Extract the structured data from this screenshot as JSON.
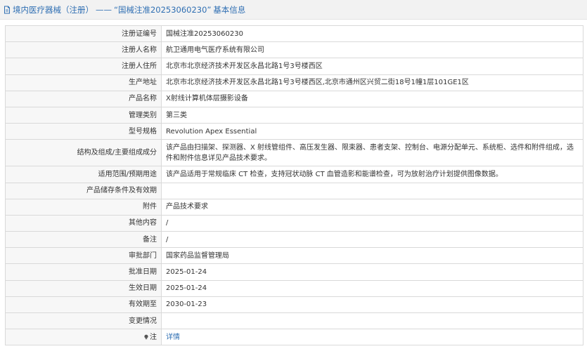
{
  "header": {
    "icon": "document-icon",
    "category": "境内医疗器械（注册）",
    "separator": "——",
    "reg_quote": "“国械注准20253060230”",
    "section": "基本信息"
  },
  "rows": [
    {
      "label": "注册证编号",
      "value": "国械注准20253060230"
    },
    {
      "label": "注册人名称",
      "value": "航卫通用电气医疗系统有限公司"
    },
    {
      "label": "注册人住所",
      "value": "北京市北京经济技术开发区永昌北路1号3号楼西区"
    },
    {
      "label": "生产地址",
      "value": "北京市北京经济技术开发区永昌北路1号3号楼西区,北京市通州区兴贸二街18号1幢1层101GE1区"
    },
    {
      "label": "产品名称",
      "value": "X射线计算机体层摄影设备"
    },
    {
      "label": "管理类别",
      "value": "第三类"
    },
    {
      "label": "型号规格",
      "value": "Revolution Apex Essential"
    },
    {
      "label": "结构及组成/主要组成成分",
      "value": "该产品由扫描架、探测器、X 射线管组件、高压发生器、限束器、患者支架、控制台、电源分配单元、系统柜、选件和附件组成，选件和附件信息详见产品技术要求。"
    },
    {
      "label": "适用范围/预期用途",
      "value": "该产品适用于常规临床 CT 检查，支持冠状动脉 CT 血管造影和能谱检查，可为放射治疗计划提供图像数据。"
    },
    {
      "label": "产品储存条件及有效期",
      "value": ""
    },
    {
      "label": "附件",
      "value": "产品技术要求"
    },
    {
      "label": "其他内容",
      "value": "/"
    },
    {
      "label": "备注",
      "value": "/"
    },
    {
      "label": "审批部门",
      "value": "国家药品监督管理局"
    },
    {
      "label": "批准日期",
      "value": "2025-01-24"
    },
    {
      "label": "生效日期",
      "value": "2025-01-24"
    },
    {
      "label": "有效期至",
      "value": "2030-01-23"
    },
    {
      "label": "变更情况",
      "value": ""
    }
  ],
  "note_row": {
    "icon": "lightbulb-icon",
    "label": "注",
    "link_text": "详情"
  },
  "colors": {
    "link": "#2f6fb3",
    "label_bg": "#f7f7f7",
    "border": "#d9d9d9",
    "header_bg": "#f2f2f2"
  }
}
